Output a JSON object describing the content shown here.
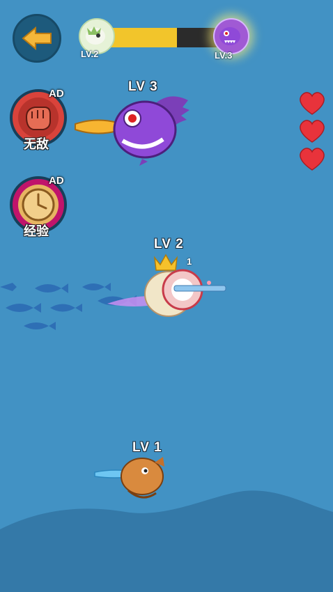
{
  "hud": {
    "progress": {
      "current_level_label": "LV.2",
      "next_level_label": "LV.3",
      "fill_fraction": 0.58
    }
  },
  "powerups": [
    {
      "label": "无敌",
      "badge": "AD",
      "icon": "fist-icon"
    },
    {
      "label": "经验",
      "badge": "AD",
      "icon": "clock-icon"
    }
  ],
  "lives": {
    "count": 3,
    "icon": "heart-icon"
  },
  "creatures": {
    "enemy_top": {
      "level_label": "LV 3"
    },
    "player": {
      "level_label": "LV 2",
      "hit_count": "1"
    },
    "enemy_bottom": {
      "level_label": "LV 1"
    }
  },
  "colors": {
    "sea": "#3f8fc0",
    "deep_sea": "#3479a8",
    "progress_fill": "#f2c52b",
    "heart": "#e8333b",
    "purple_fish": "#8f49d8"
  }
}
